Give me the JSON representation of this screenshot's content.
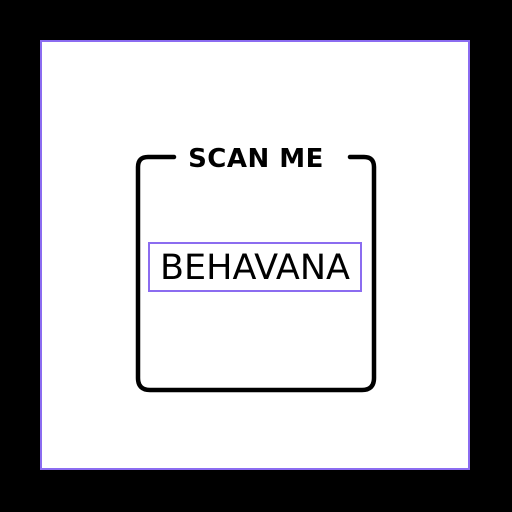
{
  "colors": {
    "background": "#000000",
    "canvas": "#ffffff",
    "selection_outline": "#8b6cf0",
    "frame": "#000000"
  },
  "frame": {
    "title": "SCAN ME"
  },
  "brand": {
    "text": "BEHAVANA"
  }
}
